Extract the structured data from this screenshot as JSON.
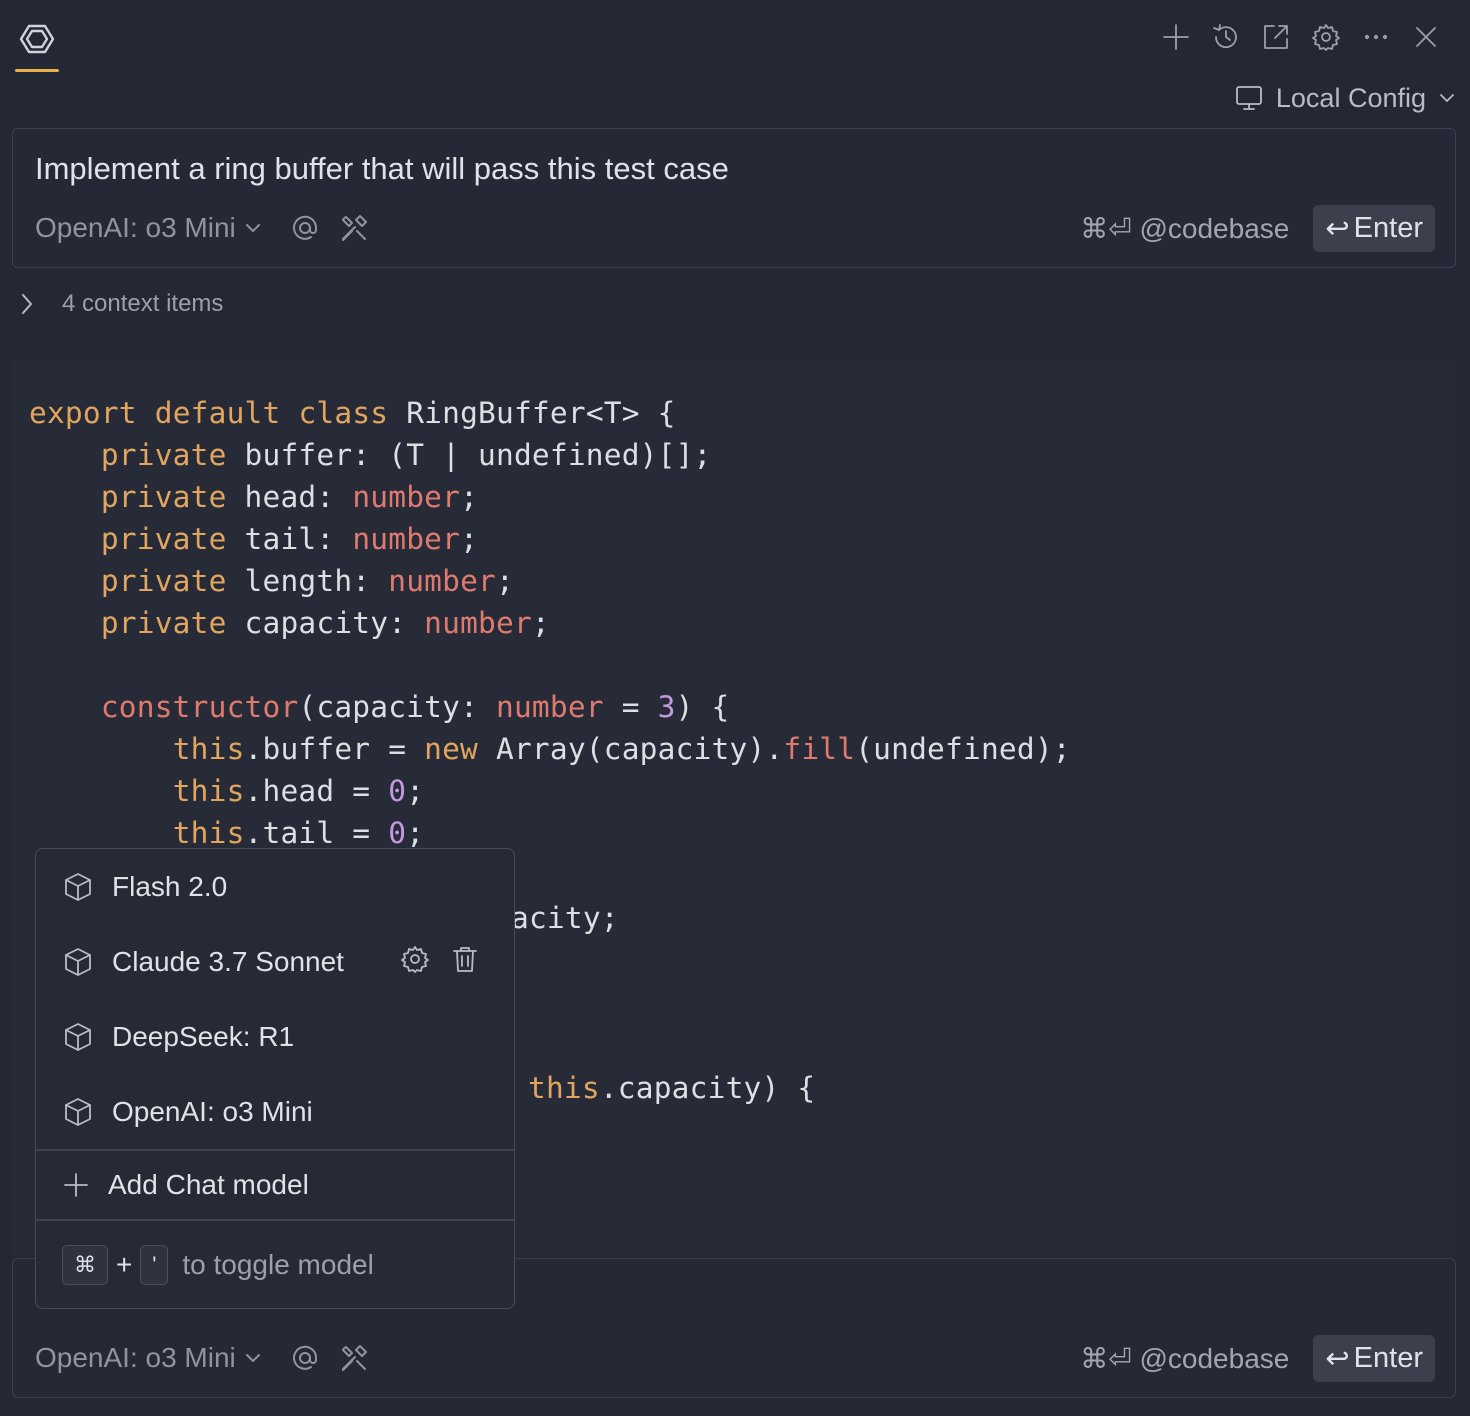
{
  "header": {
    "config_label": "Local Config",
    "toolbar_icons": [
      "plus-icon",
      "history-icon",
      "open-external-icon",
      "gear-icon",
      "more-icon",
      "close-icon"
    ]
  },
  "top_input": {
    "prompt": "Implement a ring buffer that will pass this test case",
    "model": "OpenAI: o3 Mini",
    "codebase_hint": "⌘⏎ @codebase",
    "enter_label": "Enter"
  },
  "context": {
    "label": "4 context items"
  },
  "code": {
    "l1": [
      "export",
      "default",
      "class",
      "RingBuffer<T> {"
    ],
    "l2": [
      "private",
      "buffer: (T | undefined)[];"
    ],
    "l3": [
      "private",
      "head: ",
      "number",
      ";"
    ],
    "l4": [
      "private",
      "tail: ",
      "number",
      ";"
    ],
    "l5": [
      "private",
      "length: ",
      "number",
      ";"
    ],
    "l6": [
      "private",
      "capacity: ",
      "number",
      ";"
    ],
    "l8": [
      "constructor",
      "(capacity: ",
      "number",
      " = ",
      "3",
      ") {"
    ],
    "l9": [
      "this",
      ".buffer = ",
      "new",
      " Array(capacity).",
      "fill",
      "(undefined);"
    ],
    "l10": [
      "this",
      ".head = ",
      "0",
      ";"
    ],
    "l11": [
      "this",
      ".tail = ",
      "0",
      ";"
    ],
    "l12_visible": "acity;",
    "l15_this": "this",
    "l15_rest": ".capacity) {"
  },
  "model_menu": {
    "items": [
      "Flash 2.0",
      "Claude 3.7 Sonnet",
      "DeepSeek: R1",
      "OpenAI: o3 Mini"
    ],
    "add_label": "Add Chat model",
    "hint_key1": "⌘",
    "hint_plus": "+",
    "hint_key2": "'",
    "hint_text": "to toggle model"
  },
  "bottom_input": {
    "model": "OpenAI: o3 Mini",
    "codebase_hint": "⌘⏎ @codebase",
    "enter_label": "Enter"
  },
  "colors": {
    "accent": "#e8b04a",
    "keyword": "#e2a55f",
    "type": "#e07a6f",
    "number": "#c39ae0",
    "background": "#242834"
  }
}
